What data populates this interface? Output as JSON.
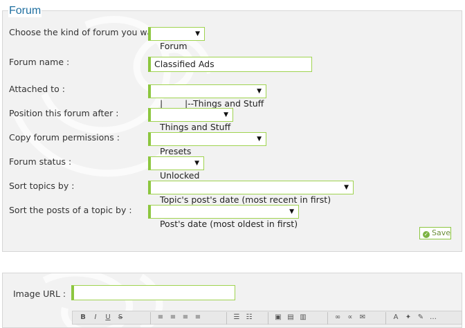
{
  "section1": {
    "legend": "Forum",
    "fields": {
      "kind": {
        "label": "Choose the kind of forum you want :",
        "value": "Forum"
      },
      "name": {
        "label": "Forum name :",
        "value": "Classified Ads"
      },
      "attached": {
        "label": "Attached to :",
        "value": "|        |--Things and Stuff"
      },
      "position": {
        "label": "Position this forum after :",
        "value": "Things and Stuff"
      },
      "permissions": {
        "label": "Copy forum permissions :",
        "value": "Presets"
      },
      "status": {
        "label": "Forum status :",
        "value": "Unlocked"
      },
      "sort_topics": {
        "label": "Sort topics by :",
        "value": "Topic's post's date (most recent in first)"
      },
      "sort_posts": {
        "label": "Sort the posts of a topic by :",
        "value": "Post's date (most oldest in first)"
      }
    },
    "save_label": "Save"
  },
  "section2": {
    "image_url_label": "Image URL :",
    "image_url_value": ""
  },
  "editor_toolbar": {
    "buttons": [
      "B",
      "I",
      "U",
      "S",
      "align-left",
      "align-center",
      "align-right",
      "justify",
      "bullet-list",
      "numbered-list",
      "image",
      "image-upload",
      "image-host",
      "link",
      "unlink",
      "email",
      "color",
      "highlight",
      "pen",
      "more"
    ]
  },
  "colors": {
    "accent_green": "#8cc63f",
    "legend_blue": "#1f6fa0",
    "panel_bg": "#f2f2f2"
  }
}
